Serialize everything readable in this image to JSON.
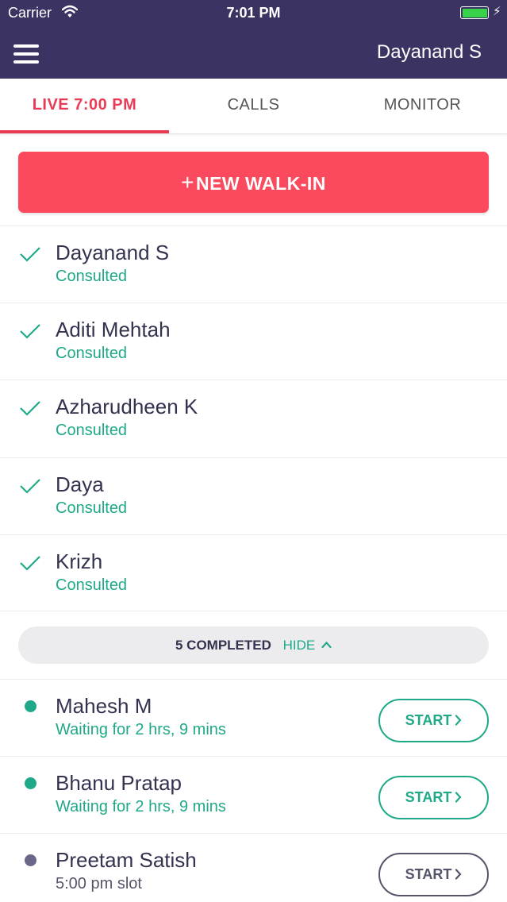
{
  "status_bar": {
    "carrier": "Carrier",
    "time": "7:01 PM"
  },
  "header": {
    "user_name": "Dayanand S"
  },
  "colors": {
    "header": "#3b3463",
    "accent_red": "#ea3b55",
    "button_red": "#fb4a5e",
    "teal": "#1fa988",
    "slate": "#55556a"
  },
  "tabs": [
    {
      "label": "LIVE 7:00 PM",
      "active": true
    },
    {
      "label": "CALLS"
    },
    {
      "label": "MONITOR"
    }
  ],
  "walkin": {
    "plus": "+",
    "label": "NEW WALK-IN"
  },
  "completed_list": [
    {
      "name": "Dayanand S",
      "status": "Consulted"
    },
    {
      "name": "Aditi Mehtah",
      "status": "Consulted"
    },
    {
      "name": "Azharudheen K",
      "status": "Consulted"
    },
    {
      "name": "Daya",
      "status": "Consulted"
    },
    {
      "name": "Krizh",
      "status": "Consulted"
    }
  ],
  "completed_bar": {
    "count_label": "5 COMPLETED",
    "hide_label": "HIDE"
  },
  "queue": [
    {
      "name": "Mahesh M",
      "status": "Waiting for 2 hrs, 9 mins",
      "button": "START"
    },
    {
      "name": "Bhanu Pratap",
      "status": "Waiting for 2 hrs, 9 mins",
      "button": "START"
    },
    {
      "name": "Preetam Satish",
      "status": "5:00 pm slot",
      "button": "START"
    }
  ]
}
